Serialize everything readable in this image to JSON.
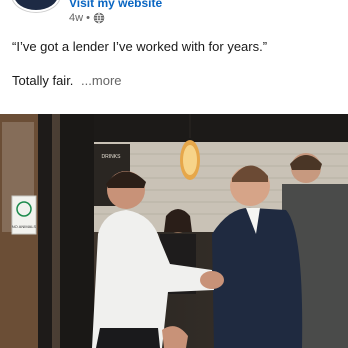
{
  "post": {
    "website_link": "Visit my website",
    "age": "4w",
    "separator": "•",
    "visibility_icon": "globe-icon",
    "quote": "“I’ve got a lender I’ve worked with for years.”",
    "line2": "Totally fair.",
    "more_label": "...more"
  },
  "photo": {
    "sign_text": "NO ANIMALS",
    "menu_text": "DRINKS"
  },
  "colors": {
    "link": "#0a66c2",
    "meta": "#666666",
    "text": "#191919"
  }
}
